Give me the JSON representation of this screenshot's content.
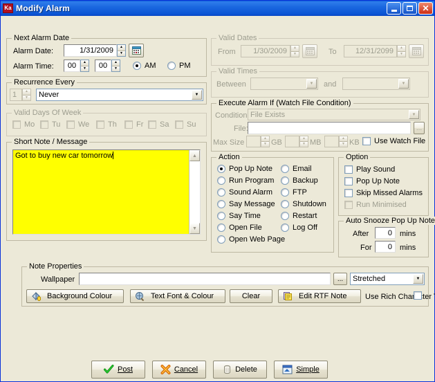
{
  "window": {
    "title": "Modify Alarm",
    "icon_label": "Ka",
    "minimize_title": "Minimize",
    "maximize_title": "Maximize",
    "close_title": "Close"
  },
  "next_alarm_date": {
    "legend": "Next Alarm Date",
    "date_label": "Alarm Date:",
    "date_value": "1/31/2009",
    "calendar_icon": "calendar-icon",
    "time_label": "Alarm Time:",
    "hour_value": "00",
    "minute_value": "00",
    "am_label": "AM",
    "pm_label": "PM",
    "meridiem_selected": "AM"
  },
  "recurrence": {
    "legend": "Recurrence Every",
    "count_value": "1",
    "interval_value": "Never"
  },
  "valid_days": {
    "legend": "Valid Days Of Week",
    "days": [
      "Mo",
      "Tu",
      "We",
      "Th",
      "Fr",
      "Sa",
      "Su"
    ],
    "checked": [],
    "enabled": false
  },
  "short_note": {
    "legend": "Short Note / Message",
    "text": "Got to buy new car tomorrow",
    "background_color": "#FFFF00",
    "scroll_up": "scroll-up-arrow",
    "scroll_down": "scroll-down-arrow"
  },
  "valid_dates": {
    "legend": "Valid Dates",
    "from_label": "From",
    "from_value": "1/30/2009",
    "to_label": "To",
    "to_value": "12/31/2099",
    "enabled": false
  },
  "valid_times": {
    "legend": "Valid Times",
    "between_label": "Between",
    "between_value": "",
    "and_label": "and",
    "and_value": "",
    "enabled": false
  },
  "execute_alarm_if": {
    "legend": "Execute Alarm If (Watch File Condition)",
    "condition_label": "Condition",
    "condition_value": "File Exists",
    "file_label": "File:",
    "file_value": "",
    "browse_label": "...",
    "max_size_label": "Max Size",
    "gb_value": "",
    "gb_unit": "GB",
    "mb_value": "",
    "mb_unit": "MB",
    "kb_value": "",
    "kb_unit": "KB",
    "use_watch_file_label": "Use Watch File",
    "use_watch_file_checked": false,
    "enabled": false
  },
  "action": {
    "legend": "Action",
    "selected": "Pop Up Note",
    "left_options": [
      "Pop Up Note",
      "Run Program",
      "Sound Alarm",
      "Say Message",
      "Say Time",
      "Open File",
      "Open Web Page"
    ],
    "right_options": [
      "Email",
      "Backup",
      "FTP",
      "Shutdown",
      "Restart",
      "Log Off"
    ]
  },
  "option": {
    "legend": "Option",
    "items": [
      {
        "label": "Play Sound",
        "checked": false,
        "enabled": true
      },
      {
        "label": "Pop Up Note",
        "checked": false,
        "enabled": true
      },
      {
        "label": "Skip Missed Alarms",
        "checked": false,
        "enabled": true
      },
      {
        "label": "Run Minimised",
        "checked": false,
        "enabled": false
      }
    ]
  },
  "auto_snooze": {
    "legend": "Auto Snooze Pop Up Note",
    "after_label": "After",
    "after_value": "0",
    "after_unit": "mins",
    "for_label": "For",
    "for_value": "0",
    "for_unit": "mins"
  },
  "note_properties": {
    "legend": "Note Properties",
    "wallpaper_label": "Wallpaper",
    "wallpaper_value": "",
    "browse_label": "...",
    "stretch_value": "Stretched",
    "background_colour_label": "Background Colour",
    "text_font_colour_label": "Text Font & Colour",
    "clear_label": "Clear",
    "edit_rtf_label": "Edit RTF Note",
    "use_rich_text_label": "Use Rich Character Text",
    "use_rich_text_checked": false
  },
  "footer": {
    "post_label": "Post",
    "cancel_label": "Cancel",
    "delete_label": "Delete",
    "simple_label": "Simple"
  },
  "colors": {
    "titlebar": "#0B54D4",
    "face": "#ECE9D8",
    "note_yellow": "#FFFF00",
    "field_border": "#7F9DB9",
    "disabled_text": "#9D9D8F"
  }
}
